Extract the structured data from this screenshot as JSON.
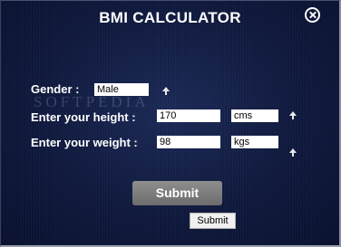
{
  "app": {
    "title": "BMI CALCULATOR",
    "close_icon": "close-icon",
    "watermark": "SOFTPEDIA"
  },
  "form": {
    "gender": {
      "label": "Gender :",
      "value": "Male"
    },
    "height": {
      "label": "Enter your height :",
      "value": "170",
      "unit": "cms"
    },
    "weight": {
      "label": "Enter your weight :",
      "value": "98",
      "unit": "kgs"
    },
    "arrow_icon": "up-arrow-icon"
  },
  "buttons": {
    "submit_big": "Submit",
    "submit_small": "Submit"
  }
}
